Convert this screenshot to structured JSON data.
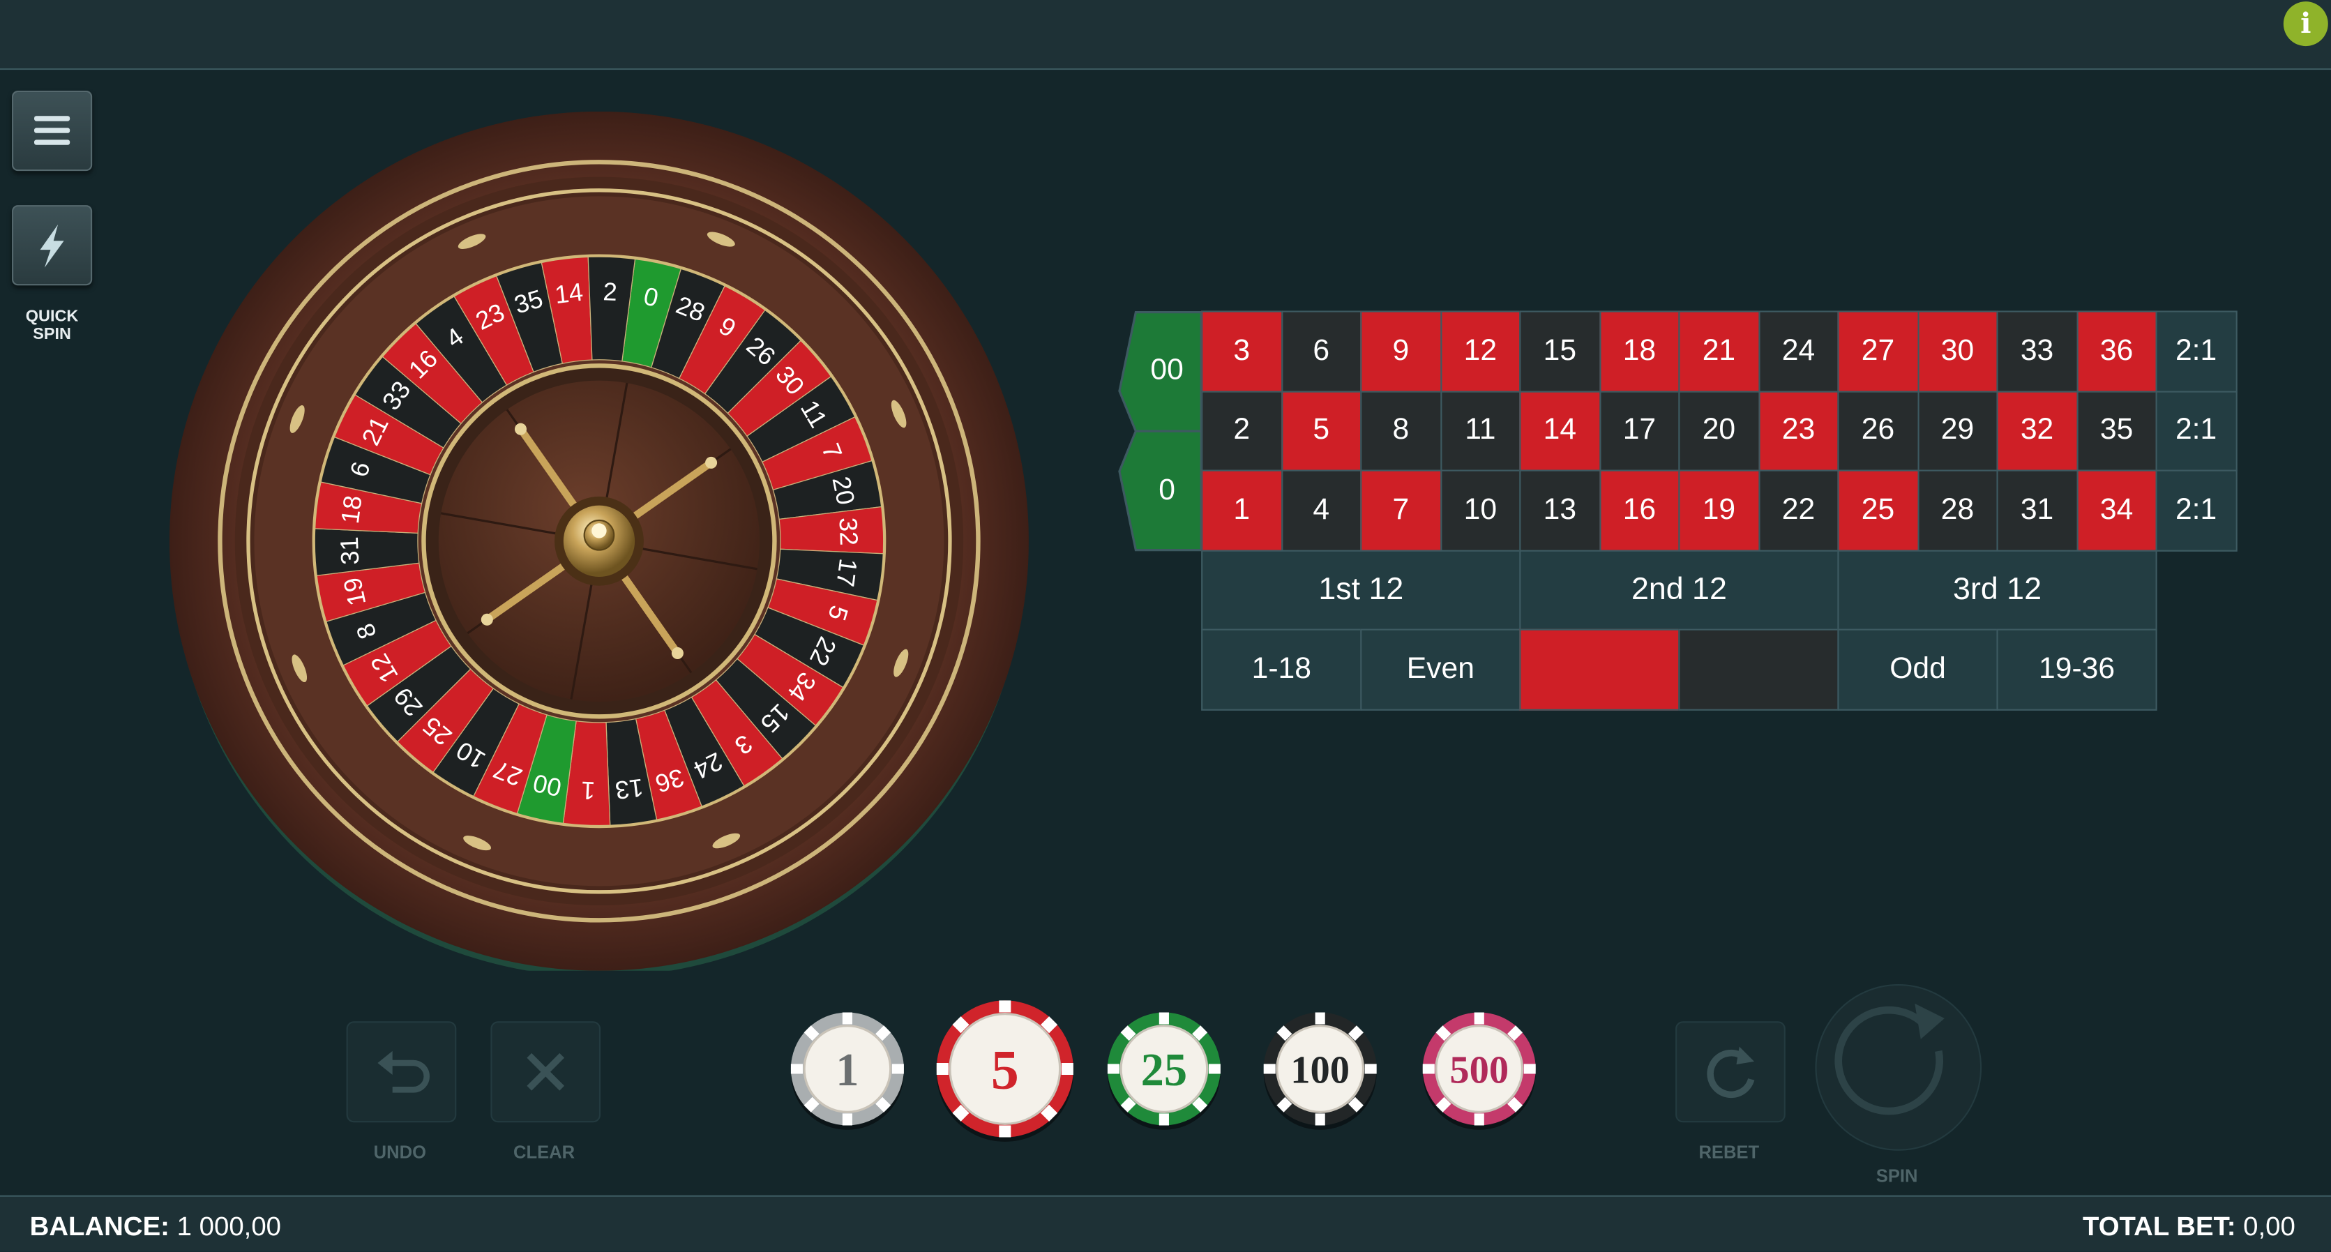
{
  "header": {
    "info_label": "i"
  },
  "side": {
    "quick_spin_label_1": "QUICK",
    "quick_spin_label_2": "SPIN"
  },
  "wheel": {
    "sequence": [
      "0",
      "28",
      "9",
      "26",
      "30",
      "11",
      "7",
      "20",
      "32",
      "17",
      "5",
      "22",
      "34",
      "15",
      "3",
      "24",
      "36",
      "13",
      "1",
      "00",
      "27",
      "10",
      "25",
      "29",
      "12",
      "8",
      "19",
      "31",
      "18",
      "6",
      "21",
      "33",
      "16",
      "4",
      "23",
      "35",
      "14",
      "2"
    ],
    "colors": {
      "red": "#cf1f26",
      "black": "#1d2122",
      "green": "#1f9a2f"
    }
  },
  "board": {
    "zeros": [
      "00",
      "0"
    ],
    "rows": [
      [
        {
          "n": "3",
          "c": "red"
        },
        {
          "n": "6",
          "c": "black"
        },
        {
          "n": "9",
          "c": "red"
        },
        {
          "n": "12",
          "c": "red"
        },
        {
          "n": "15",
          "c": "black"
        },
        {
          "n": "18",
          "c": "red"
        },
        {
          "n": "21",
          "c": "red"
        },
        {
          "n": "24",
          "c": "black"
        },
        {
          "n": "27",
          "c": "red"
        },
        {
          "n": "30",
          "c": "red"
        },
        {
          "n": "33",
          "c": "black"
        },
        {
          "n": "36",
          "c": "red"
        }
      ],
      [
        {
          "n": "2",
          "c": "black"
        },
        {
          "n": "5",
          "c": "red"
        },
        {
          "n": "8",
          "c": "black"
        },
        {
          "n": "11",
          "c": "black"
        },
        {
          "n": "14",
          "c": "red"
        },
        {
          "n": "17",
          "c": "black"
        },
        {
          "n": "20",
          "c": "black"
        },
        {
          "n": "23",
          "c": "red"
        },
        {
          "n": "26",
          "c": "black"
        },
        {
          "n": "29",
          "c": "black"
        },
        {
          "n": "32",
          "c": "red"
        },
        {
          "n": "35",
          "c": "black"
        }
      ],
      [
        {
          "n": "1",
          "c": "red"
        },
        {
          "n": "4",
          "c": "black"
        },
        {
          "n": "7",
          "c": "red"
        },
        {
          "n": "10",
          "c": "black"
        },
        {
          "n": "13",
          "c": "black"
        },
        {
          "n": "16",
          "c": "red"
        },
        {
          "n": "19",
          "c": "red"
        },
        {
          "n": "22",
          "c": "black"
        },
        {
          "n": "25",
          "c": "red"
        },
        {
          "n": "28",
          "c": "black"
        },
        {
          "n": "31",
          "c": "black"
        },
        {
          "n": "34",
          "c": "red"
        }
      ]
    ],
    "column_bet": "2:1",
    "dozens": [
      "1st 12",
      "2nd 12",
      "3rd 12"
    ],
    "outside": [
      "1-18",
      "Even",
      "",
      "",
      "Odd",
      "19-36"
    ]
  },
  "controls": {
    "undo": "UNDO",
    "clear": "CLEAR",
    "rebet": "REBET",
    "spin": "SPIN"
  },
  "chips": [
    {
      "value": "1",
      "color": "#a9aeb0",
      "text_color": "#6b6f70"
    },
    {
      "value": "5",
      "color": "#d0242b",
      "text_color": "#d0242b"
    },
    {
      "value": "25",
      "color": "#1f8a3a",
      "text_color": "#1f8a3a"
    },
    {
      "value": "100",
      "color": "#222627",
      "text_color": "#222627"
    },
    {
      "value": "500",
      "color": "#c43a6b",
      "text_color": "#b02a5a"
    }
  ],
  "footer": {
    "balance_label": "BALANCE:",
    "balance_value": "1 000,00",
    "total_bet_label": "TOTAL BET:",
    "total_bet_value": "0,00"
  }
}
